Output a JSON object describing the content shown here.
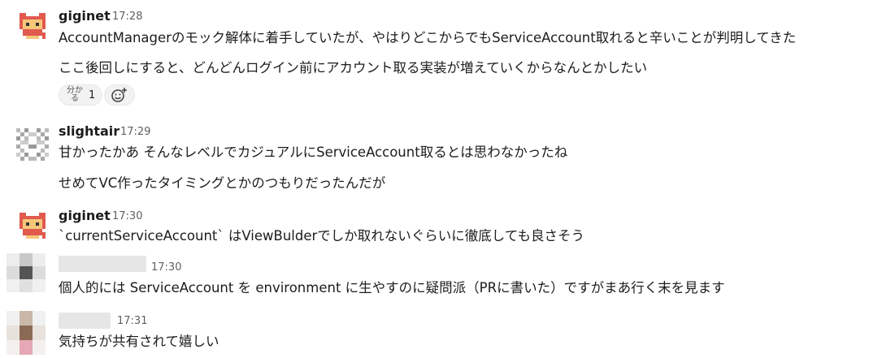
{
  "messages": [
    {
      "user": "giginet",
      "time": "17:28",
      "lines": [
        "AccountManagerのモック解体に着手していたが、やはりどこからでもServiceAccount取れると辛いことが判明してきた",
        "ここ後回しにすると、どんどんログイン前にアカウント取る実装が増えていくからなんとかしたい"
      ],
      "reaction": {
        "emoji_text": "分かる",
        "count": "1"
      }
    },
    {
      "user": "slightair",
      "time": "17:29",
      "lines": [
        "甘かったかあ そんなレベルでカジュアルにServiceAccount取るとは思わなかったね",
        "せめてVC作ったタイミングとかのつもりだったんだが"
      ]
    },
    {
      "user": "giginet",
      "time": "17:30",
      "lines": [
        "`currentServiceAccount` はViewBulderでしか取れないぐらいに徹底しても良さそう"
      ]
    },
    {
      "user": "",
      "time": "17:30",
      "lines": [
        "個人的には ServiceAccount を environment に生やすのに疑問派（PRに書いた）ですがまあ行く末を見ます"
      ]
    },
    {
      "user": "",
      "time": "17:31",
      "lines": [
        "気持ちが共有されて嬉しい"
      ]
    }
  ],
  "icons": {
    "add_reaction": "add-reaction-icon",
    "avatar_giginet": "pixel-cat-avatar",
    "avatar_slightair": "identicon-avatar"
  },
  "colors": {
    "text": "#1d1c1d",
    "muted": "#616061",
    "avatar_red": "#e05a4e"
  }
}
